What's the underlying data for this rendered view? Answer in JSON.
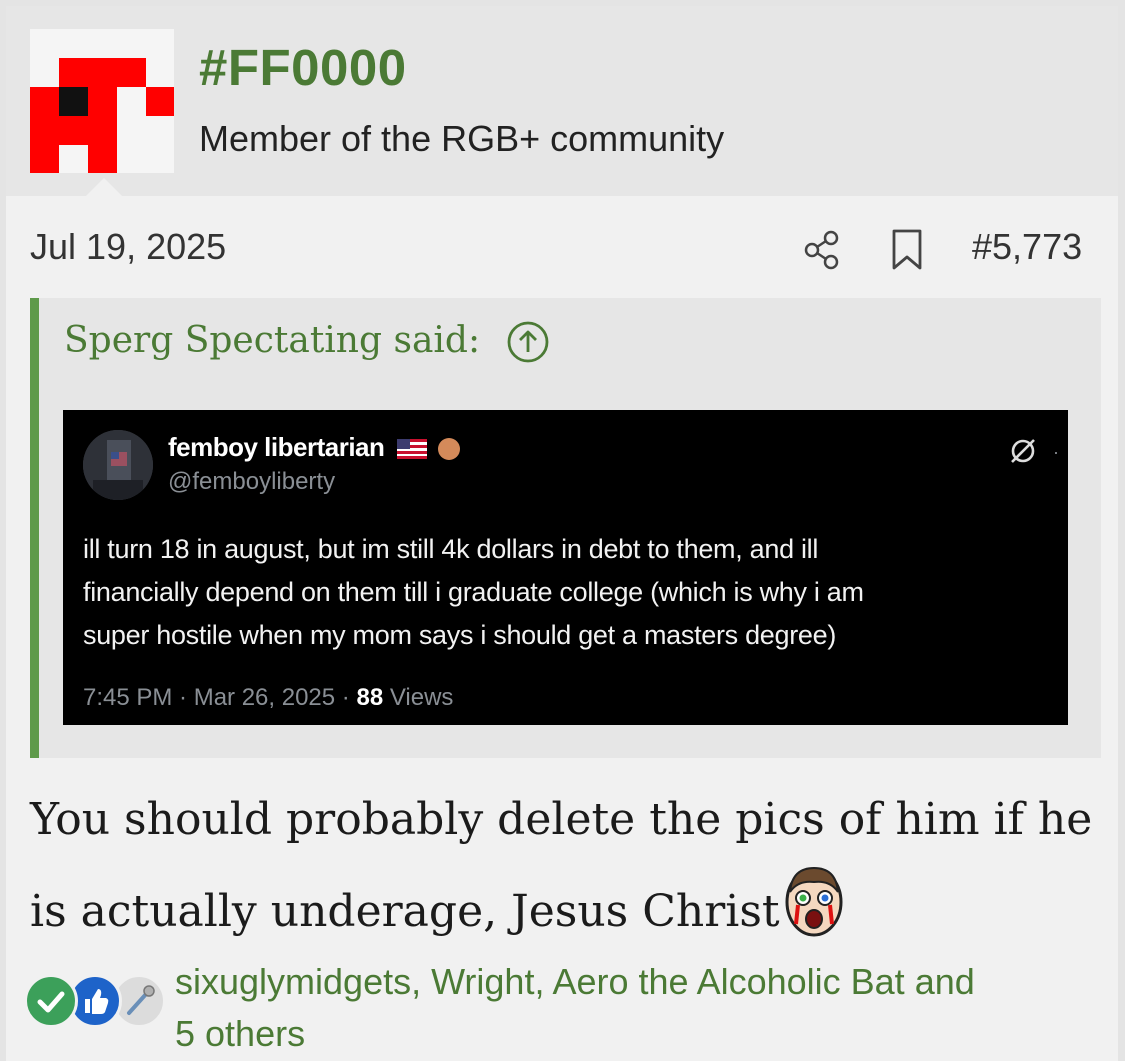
{
  "author": {
    "username": "#FF0000",
    "title": "Member of the RGB+ community"
  },
  "post": {
    "date": "Jul 19, 2025",
    "number": "#5,773",
    "body_line1": "You should probably delete the pics of him if he",
    "body_line2": "is actually underage, Jesus Christ"
  },
  "quote": {
    "author_said": "Sperg Spectating said:",
    "tweet": {
      "display_name": "femboy libertarian",
      "handle": "@femboyliberty",
      "text_lines": [
        "ill turn 18 in august, but im still 4k dollars in debt to them, and ill",
        "financially depend on them till i graduate college (which is why i am",
        "super hostile when my mom says i should get a masters degree)"
      ],
      "timestamp": "7:45 PM · Mar 26, 2025 · ",
      "views_count": "88",
      "views_label": " Views"
    }
  },
  "reactions": {
    "users_line1": "sixuglymidgets, Wright, Aero the Alcoholic Bat and",
    "users_line2": "5 others",
    "icons": [
      "check-reaction-icon",
      "like-reaction-icon",
      "pin-reaction-icon"
    ]
  },
  "colors": {
    "accent_green": "#4b7a35",
    "quote_bar": "#5e9a4a",
    "avatar_red": "#ff0000"
  }
}
